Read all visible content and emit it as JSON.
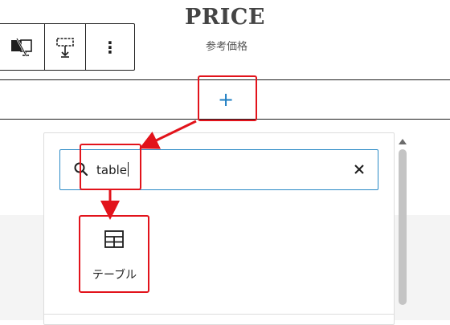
{
  "heading": {
    "title": "PRICE",
    "subtitle": "参考価格"
  },
  "toolbar": {
    "buttons": [
      {
        "icon": "media-text-swap-icon"
      },
      {
        "icon": "vertical-align-icon"
      },
      {
        "icon": "more-options-icon",
        "label": "⋮"
      }
    ]
  },
  "inserter": {
    "plus_label": "+"
  },
  "search": {
    "value": "table",
    "icon": "search-icon",
    "clear_icon": "close-icon"
  },
  "results": [
    {
      "label": "テーブル",
      "icon": "table-icon"
    }
  ],
  "colors": {
    "accent": "#2a8ac6",
    "annotation": "#e2131b",
    "text": "#1e1e1e"
  }
}
